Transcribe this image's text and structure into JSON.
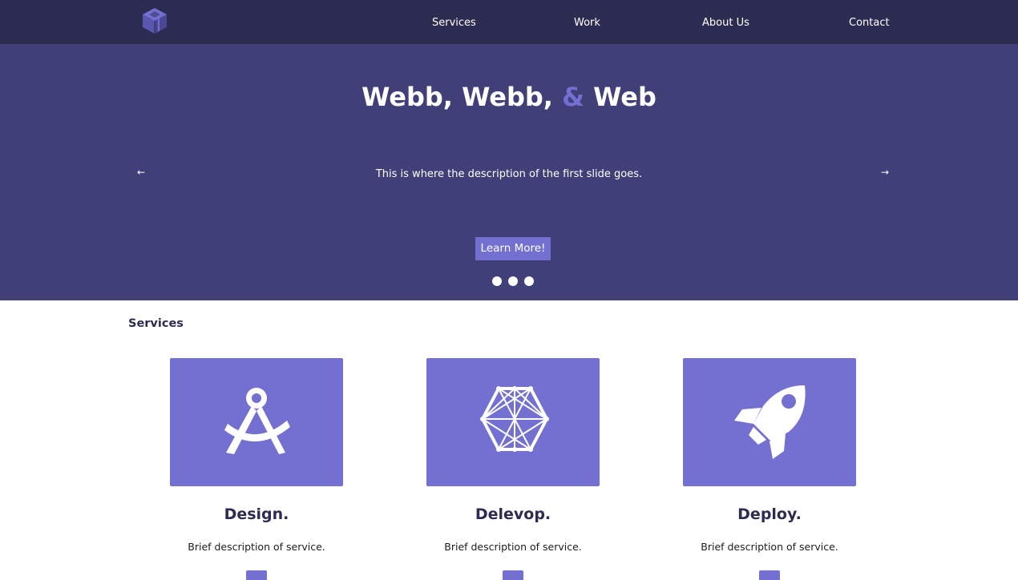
{
  "colors": {
    "navbar_bg": "#2c2c52",
    "hero_bg": "#403f78",
    "accent": "#7370d1",
    "text_dark": "#2c2c52",
    "white": "#ffffff"
  },
  "navbar": {
    "logo_icon": "geometric-cube-logo",
    "items": [
      {
        "label": "Services"
      },
      {
        "label": "Work"
      },
      {
        "label": "About Us"
      },
      {
        "label": "Contact"
      }
    ]
  },
  "hero": {
    "title_part1": "Webb, Webb, ",
    "title_amp": "&",
    "title_part2": " Web",
    "description": "This is where the description of the first slide goes.",
    "prev_arrow": "←",
    "next_arrow": "→",
    "cta_label": "Learn More!",
    "slide_count": 3
  },
  "services": {
    "heading": "Services",
    "cards": [
      {
        "icon": "compass-drafting-icon",
        "title": "Design.",
        "description": "Brief description of service."
      },
      {
        "icon": "hexagon-network-icon",
        "title": "Delevop.",
        "description": "Brief description of service."
      },
      {
        "icon": "rocket-icon",
        "title": "Deploy.",
        "description": "Brief description of service."
      }
    ]
  }
}
